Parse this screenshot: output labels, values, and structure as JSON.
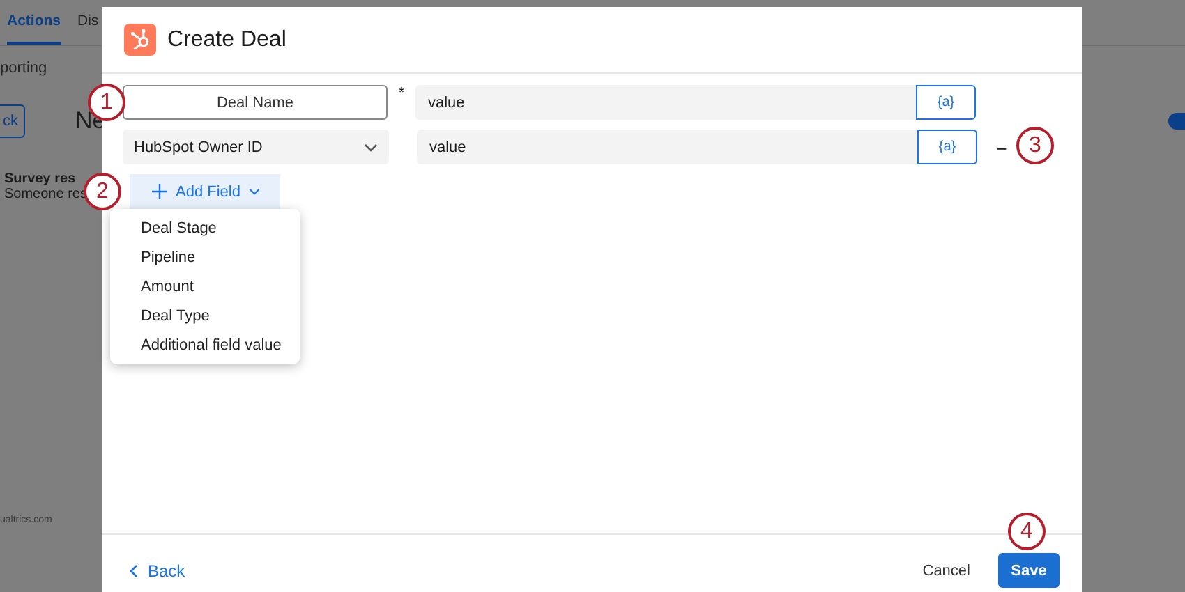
{
  "background": {
    "tabs": [
      {
        "label": "Actions",
        "selected": true
      },
      {
        "label": "Dis",
        "selected": false
      }
    ],
    "subnav": "porting",
    "back_button": "ck",
    "heading": "Ne",
    "card_title": "Survey res",
    "card_text": "Someone res",
    "logo_text": "ualtrics.com",
    "toggle_on": true
  },
  "modal": {
    "title": "Create Deal",
    "fields": [
      {
        "kind": "text",
        "key": "Deal Name",
        "required": true,
        "value": "value",
        "piped_text": "{a}",
        "removable": false
      },
      {
        "kind": "select",
        "key": "HubSpot Owner ID",
        "required": false,
        "value": "value",
        "piped_text": "{a}",
        "removable": true
      }
    ],
    "remove_symbol": "–",
    "required_marker": "*",
    "add_field": "Add Field",
    "menu": [
      "Deal Stage",
      "Pipeline",
      "Amount",
      "Deal Type",
      "Additional field value"
    ],
    "back": "Back",
    "cancel": "Cancel",
    "save": "Save"
  },
  "callouts": [
    "1",
    "2",
    "3",
    "4"
  ]
}
